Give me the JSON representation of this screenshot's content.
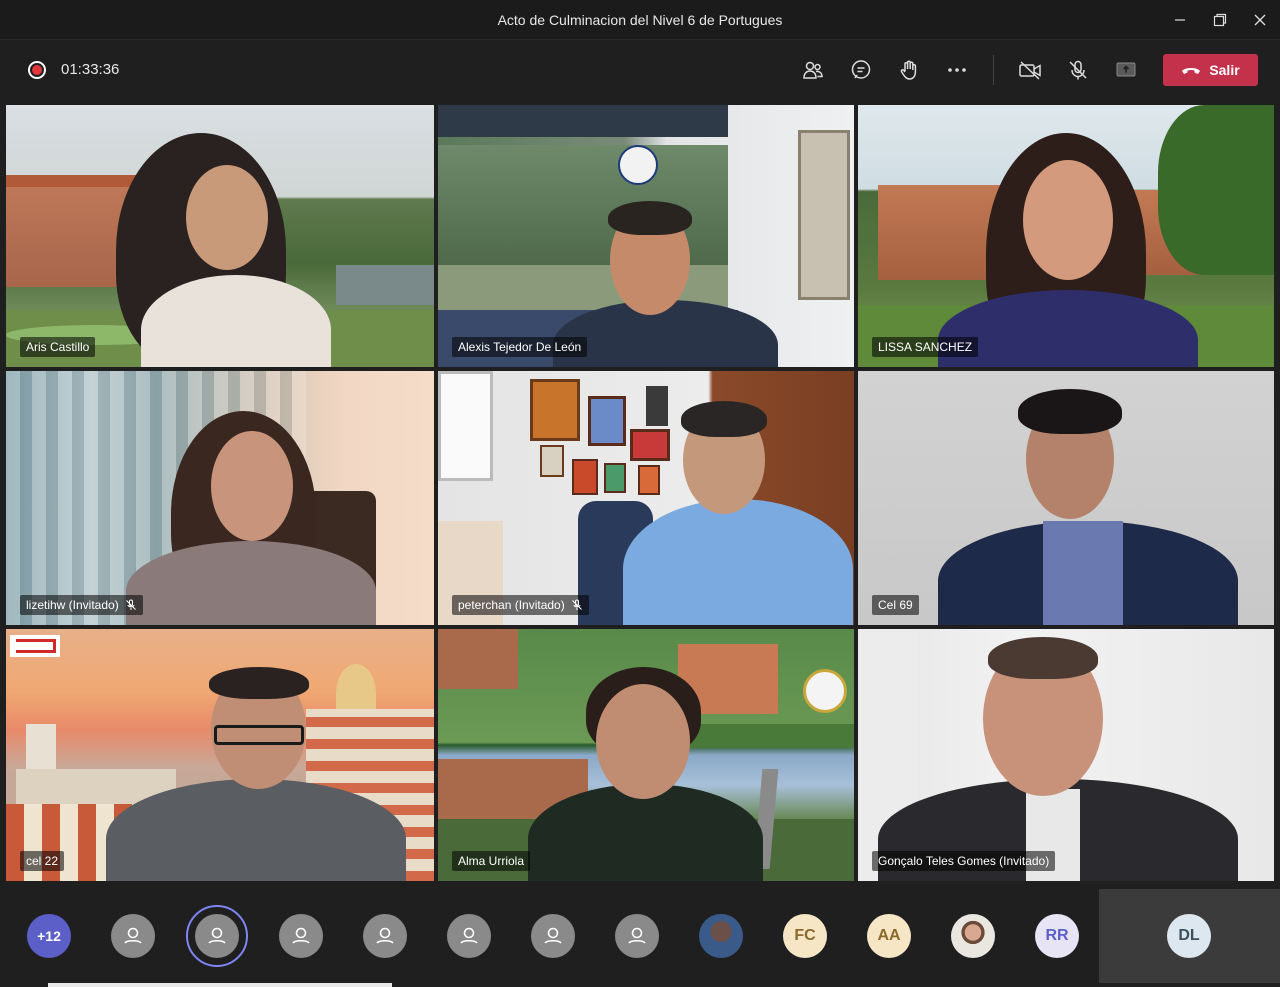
{
  "window": {
    "title": "Acto de Culminacion del Nivel 6 de Portugues",
    "controls": [
      "minimize-icon",
      "restore-icon",
      "close-icon"
    ]
  },
  "toolbar": {
    "recording_icon": "record-icon",
    "elapsed": "01:33:36",
    "buttons": [
      "participants-icon",
      "chat-icon",
      "raise-hand-icon",
      "more-options-icon",
      "camera-off-icon",
      "mic-off-icon",
      "share-screen-icon"
    ],
    "leave_label": "Salir",
    "leave_color": "#c4314b"
  },
  "participants": [
    {
      "name": "Aris Castillo",
      "muted": false
    },
    {
      "name": "Alexis Tejedor De León",
      "muted": false
    },
    {
      "name": "LISSA SANCHEZ",
      "muted": false
    },
    {
      "name": "lizetihw (Invitado)",
      "muted": true
    },
    {
      "name": "peterchan (Invitado)",
      "muted": true
    },
    {
      "name": "Cel 69",
      "muted": false
    },
    {
      "name": "cel 22",
      "muted": false
    },
    {
      "name": "Alma Urriola",
      "muted": false
    },
    {
      "name": "Gonçalo Teles Gomes (Invitado)",
      "muted": false
    }
  ],
  "tray": {
    "overflow_label": "+12",
    "avatars": [
      {
        "type": "generic"
      },
      {
        "type": "generic",
        "speaking": true
      },
      {
        "type": "generic"
      },
      {
        "type": "generic"
      },
      {
        "type": "generic"
      },
      {
        "type": "generic"
      },
      {
        "type": "generic"
      },
      {
        "type": "photo"
      },
      {
        "type": "initials",
        "label": "FC"
      },
      {
        "type": "initials",
        "label": "AA"
      },
      {
        "type": "photo"
      },
      {
        "type": "initials",
        "label": "RR"
      }
    ],
    "self_initials": "DL"
  },
  "colors": {
    "accent": "#7f85f5",
    "overflow": "#5b5fc7"
  }
}
